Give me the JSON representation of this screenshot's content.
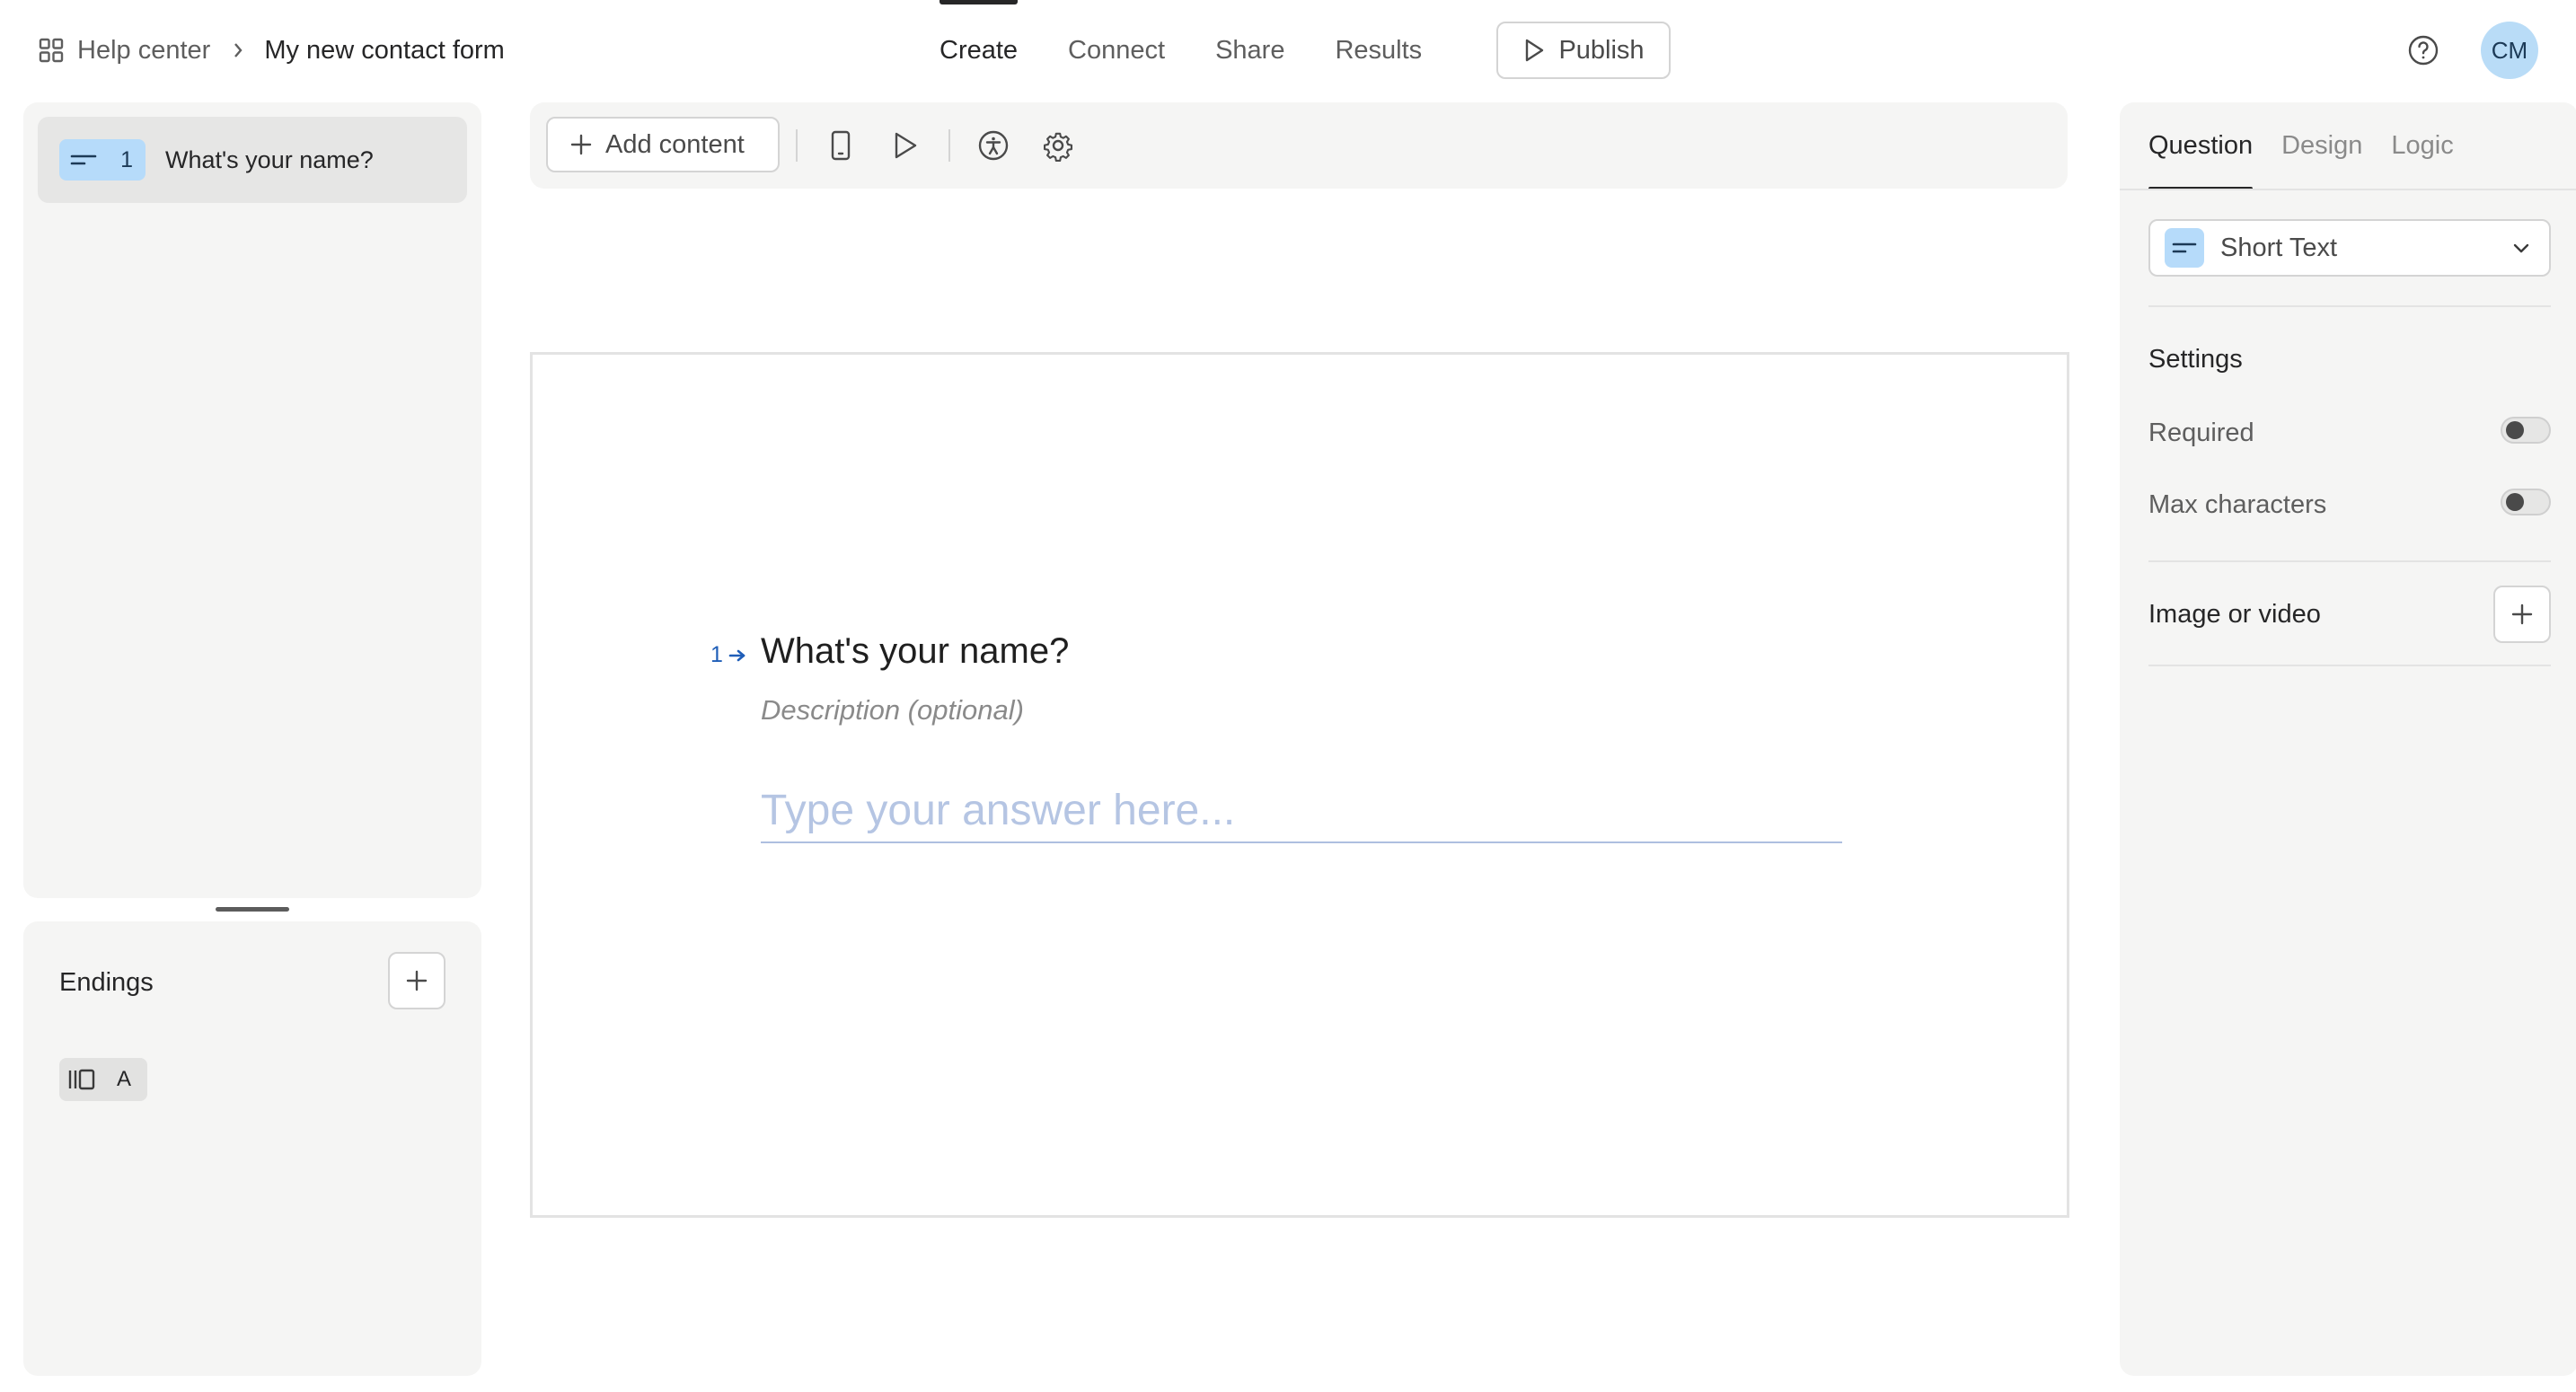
{
  "breadcrumb": {
    "workspace": "Help center",
    "form": "My new contact form"
  },
  "nav": {
    "tabs": [
      {
        "label": "Create",
        "active": true
      },
      {
        "label": "Connect",
        "active": false
      },
      {
        "label": "Share",
        "active": false
      },
      {
        "label": "Results",
        "active": false
      }
    ],
    "publish_label": "Publish"
  },
  "user": {
    "initials": "CM",
    "avatar_color": "#b9dcf7"
  },
  "questions": [
    {
      "number": "1",
      "title": "What's your name?",
      "icon": "short-text-icon"
    }
  ],
  "endings": {
    "title": "Endings",
    "items": [
      {
        "label": "A",
        "icon": "ending-icon"
      }
    ]
  },
  "toolbar": {
    "add_content_label": "Add content",
    "icons": [
      "mobile-preview-icon",
      "play-icon",
      "accessibility-icon",
      "gear-icon"
    ]
  },
  "canvas": {
    "question_number": "1",
    "question_title": "What's your name?",
    "description_placeholder": "Description (optional)",
    "answer_placeholder": "Type your answer here..."
  },
  "right_panel": {
    "tabs": [
      {
        "label": "Question",
        "active": true
      },
      {
        "label": "Design",
        "active": false
      },
      {
        "label": "Logic",
        "active": false
      }
    ],
    "question_type": "Short Text",
    "settings_title": "Settings",
    "settings": [
      {
        "label": "Required",
        "enabled": false
      },
      {
        "label": "Max characters",
        "enabled": false
      }
    ],
    "media_label": "Image or video"
  },
  "colors": {
    "accent_blue": "#b6dbfa",
    "panel_bg": "#f5f5f4",
    "link_blue": "#1f5eb8"
  }
}
